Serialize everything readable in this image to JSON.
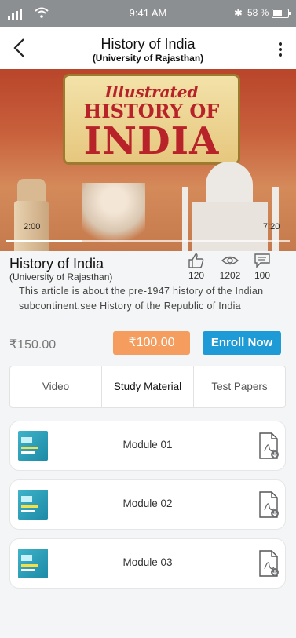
{
  "status_bar": {
    "time": "9:41 AM",
    "battery": "58 %",
    "signal_icon": "signal-bars-icon",
    "wifi_icon": "wifi-icon",
    "bluetooth_icon": "bluetooth-icon",
    "battery_level": 0.58
  },
  "header": {
    "title": "History of India",
    "subtitle": "(University of Rajasthan)",
    "back_icon": "chevron-left-icon",
    "menu_icon": "more-vertical-icon"
  },
  "video": {
    "cover_text": {
      "line1": "Illustrated",
      "line2": "HISTORY OF",
      "line3": "INDIA"
    },
    "elapsed": "2:00",
    "duration": "7:20",
    "progress": 0.27
  },
  "course": {
    "title": "History of India",
    "subtitle": "(University of Rajasthan)",
    "stats": {
      "likes": "120",
      "views": "1202",
      "comments": "100"
    },
    "description": "This article is about the pre-1947 history of the Indian subcontinent.see History of the Republic of India",
    "old_price": "₹150.00",
    "price": "₹100.00",
    "enroll_label": "Enroll Now"
  },
  "tabs": [
    {
      "label": "Video"
    },
    {
      "label": "Study Material"
    },
    {
      "label": "Test Papers"
    }
  ],
  "active_tab": "Study Material",
  "modules": [
    {
      "label": "Module 01"
    },
    {
      "label": "Module 02"
    },
    {
      "label": "Module 03"
    }
  ],
  "colors": {
    "price_button": "#f49d5e",
    "enroll_button": "#1e9bd7",
    "status_bar": "#8c8f92"
  }
}
